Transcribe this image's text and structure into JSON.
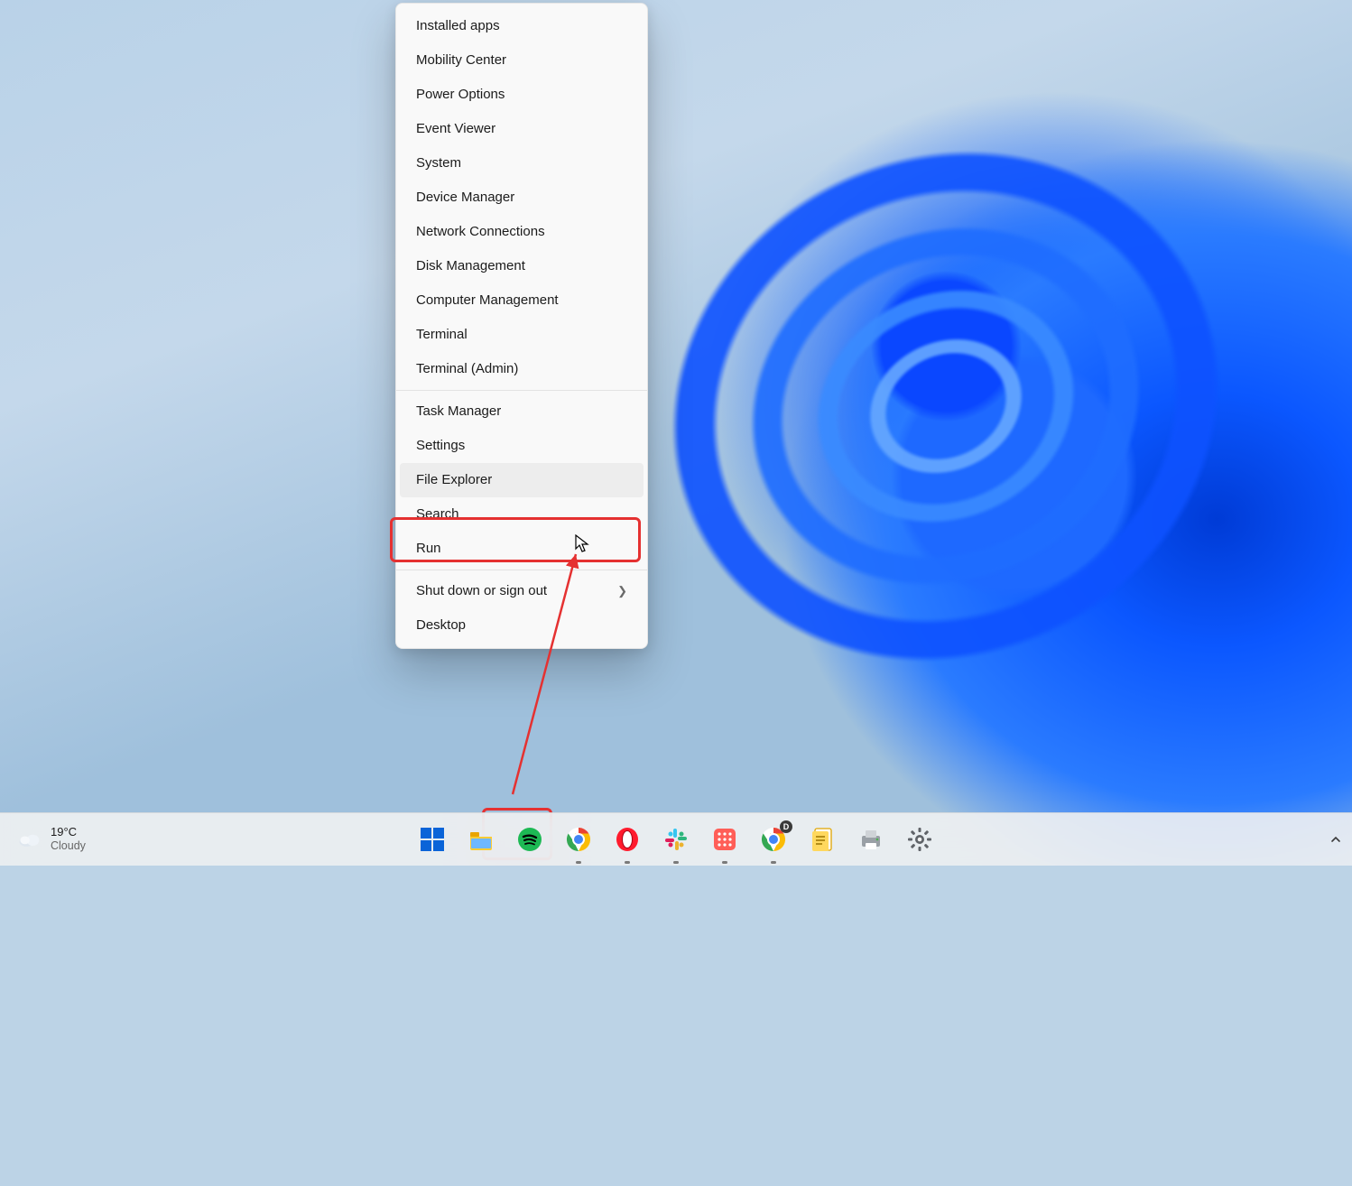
{
  "menu": {
    "items": [
      "Installed apps",
      "Mobility Center",
      "Power Options",
      "Event Viewer",
      "System",
      "Device Manager",
      "Network Connections",
      "Disk Management",
      "Computer Management",
      "Terminal",
      "Terminal (Admin)"
    ],
    "items2": [
      "Task Manager",
      "Settings",
      "File Explorer",
      "Search",
      "Run"
    ],
    "items3": [
      "Shut down or sign out",
      "Desktop"
    ],
    "hover_label": "File Explorer",
    "submenu_label": "Shut down or sign out"
  },
  "weather": {
    "temp": "19°C",
    "cond": "Cloudy"
  },
  "taskbar": {
    "apps": [
      {
        "id": "start",
        "name": "start-button",
        "running": false
      },
      {
        "id": "explorer",
        "name": "file-explorer-app-icon",
        "running": false
      },
      {
        "id": "spotify",
        "name": "spotify-app-icon",
        "running": false
      },
      {
        "id": "chrome",
        "name": "chrome-app-icon",
        "running": true
      },
      {
        "id": "opera",
        "name": "opera-app-icon",
        "running": true
      },
      {
        "id": "slack",
        "name": "slack-app-icon",
        "running": true
      },
      {
        "id": "todo",
        "name": "calendar-app-icon",
        "running": true
      },
      {
        "id": "chrome-dev",
        "name": "chrome-dev-app-icon",
        "running": true
      },
      {
        "id": "notes",
        "name": "notes-app-icon",
        "running": false
      },
      {
        "id": "printer",
        "name": "device-app-icon",
        "running": false
      },
      {
        "id": "settings",
        "name": "settings-app-icon",
        "running": false
      }
    ]
  },
  "annotation": {
    "arrow_from": "start-button",
    "arrow_to": "menu-item-file-explorer"
  }
}
